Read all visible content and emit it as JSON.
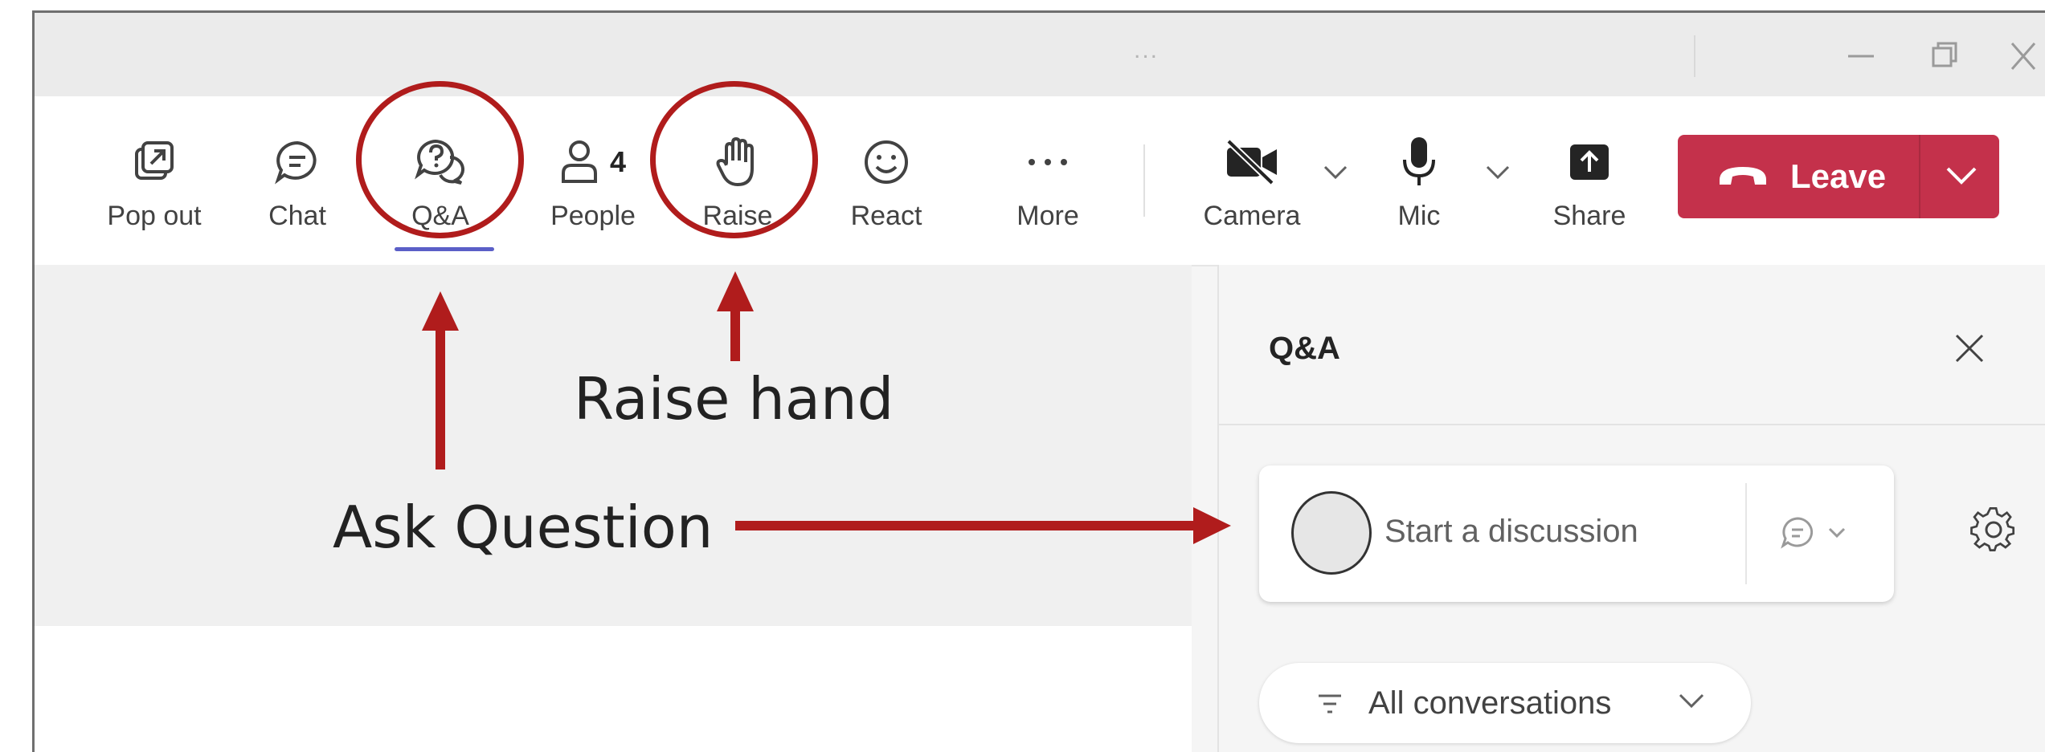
{
  "titlebar": {
    "dots": "...",
    "minimize": "—",
    "restore": "❐",
    "close": "✕"
  },
  "toolbar": {
    "items": [
      {
        "label": "Pop out",
        "icon": "pop-out-icon"
      },
      {
        "label": "Chat",
        "icon": "chat-icon"
      },
      {
        "label": "Q&A",
        "icon": "qa-icon",
        "active": true
      },
      {
        "label": "People",
        "icon": "people-icon",
        "count": "4"
      },
      {
        "label": "Raise",
        "icon": "raise-hand-icon"
      },
      {
        "label": "React",
        "icon": "react-icon"
      },
      {
        "label": "More",
        "icon": "more-icon"
      },
      {
        "label": "Camera",
        "icon": "camera-off-icon"
      },
      {
        "label": "Mic",
        "icon": "mic-icon"
      },
      {
        "label": "Share",
        "icon": "share-icon"
      }
    ],
    "leave_label": "Leave"
  },
  "panel": {
    "title": "Q&A",
    "discussion_placeholder": "Start a discussion",
    "filter_label": "All conversations"
  },
  "annotations": {
    "raise_hand": "Raise hand",
    "ask_question": "Ask Question"
  },
  "colors": {
    "leave_red": "#c4314b",
    "annotation_red": "#b01c1c",
    "active_underline": "#5b5fc7"
  }
}
